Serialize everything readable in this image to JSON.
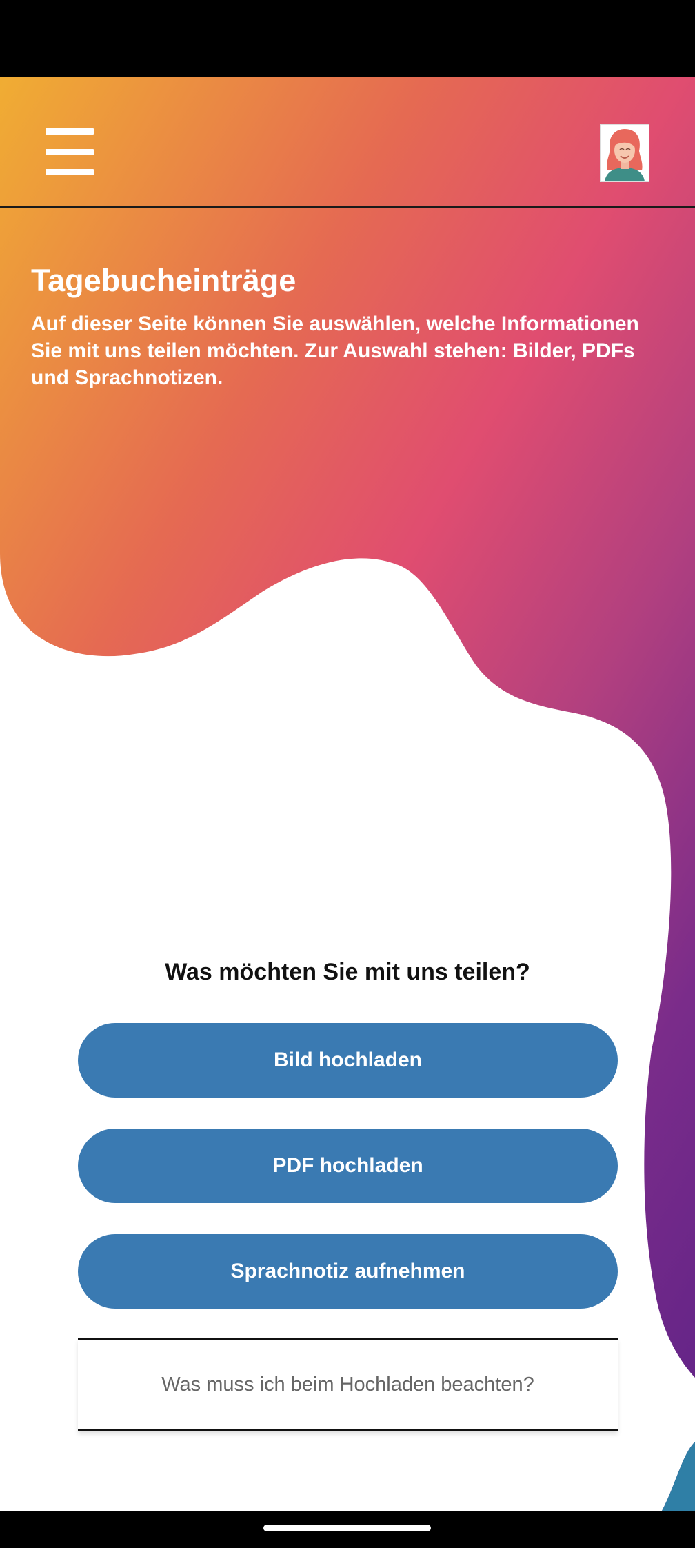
{
  "header": {
    "menu_icon": "hamburger-menu-icon",
    "avatar_icon": "user-avatar-icon"
  },
  "intro": {
    "title": "Tagebucheinträge",
    "description": "Auf dieser Seite können Sie auswählen, welche Informationen Sie mit uns teilen möchten. Zur Auswahl stehen: Bilder, PDFs und Sprachnotizen."
  },
  "share": {
    "question": "Was möchten Sie mit uns teilen?",
    "upload_image_label": "Bild hochladen",
    "upload_pdf_label": "PDF hochladen",
    "record_voice_label": "Sprachnotiz aufnehmen"
  },
  "faq": {
    "label": "Was muss ich beim Hochladen beachten?"
  },
  "colors": {
    "button": "#3a7ab2",
    "gradient_start": "#f0ad33",
    "gradient_mid": "#e04d70",
    "gradient_end": "#5e2287"
  }
}
